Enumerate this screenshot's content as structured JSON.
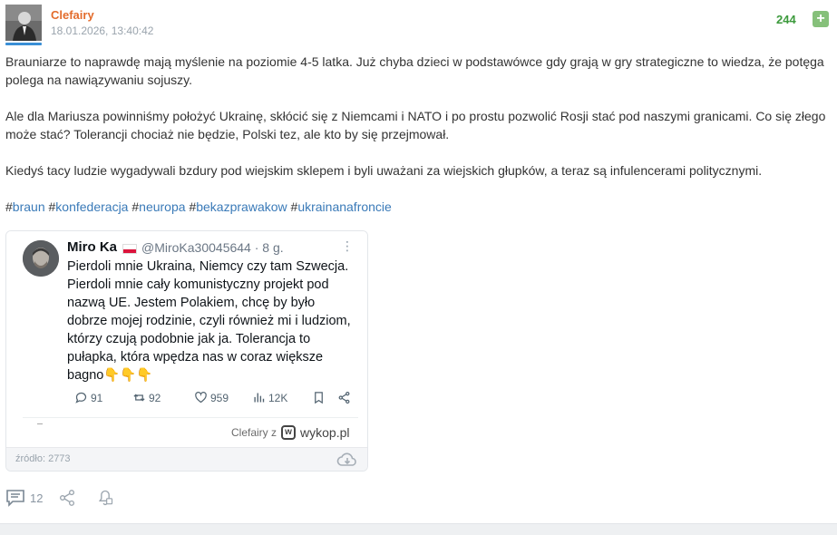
{
  "post": {
    "author": "Clefairy",
    "date": "18.01.2026, 13:40:42",
    "votes": "244",
    "plus_label": "+",
    "paragraphs": [
      "Brauniarze to naprawdę mają myślenie na poziomie 4-5 latka. Już chyba dzieci w podstawówce gdy grają w gry strategiczne to wiedza, że potęga polega na nawiązywaniu sojuszy.",
      "Ale dla Mariusza powinniśmy położyć Ukrainę, skłócić się z Niemcami i NATO i po prostu pozwolić Rosji stać pod naszymi granicami. Co się złego może stać? Tolerancji chociaż nie będzie, Polski tez, ale kto by się przejmował.",
      "Kiedyś tacy ludzie wygadywali bzdury pod wiejskim sklepem i byli uważani za wiejskich głupków, a teraz są infulencerami politycznymi."
    ],
    "tags": [
      "braun",
      "konfederacja",
      "neuropa",
      "bekazprawakow",
      "ukrainanafroncie"
    ]
  },
  "tweet": {
    "name": "Miro Ka",
    "handle": "@MiroKa30045644 · 8 g.",
    "more": "⋮",
    "text": "Pierdoli mnie Ukraina, Niemcy czy tam Szwecja. Pierdoli mnie cały komunistyczny projekt pod nazwą UE. Jestem Polakiem, chcę by było dobrze mojej rodzinie, czyli również mi i ludziom, którzy czują podobnie jak ja. Tolerancja to pułapka, która wpędza nas w coraz większe bagno👇👇👇",
    "replies": "91",
    "retweets": "92",
    "likes": "959",
    "views": "12K"
  },
  "watermark": {
    "by": "Clefairy  z",
    "logo_letter": "w",
    "site": "wykop.pl"
  },
  "card": {
    "source": "źródło: 2773"
  },
  "actions": {
    "comments_count": "12"
  },
  "colors": {
    "author": "#e36c2c",
    "votes": "#3c9a3c",
    "tag": "#3a7ab8",
    "plus_button": "#86c07a"
  }
}
